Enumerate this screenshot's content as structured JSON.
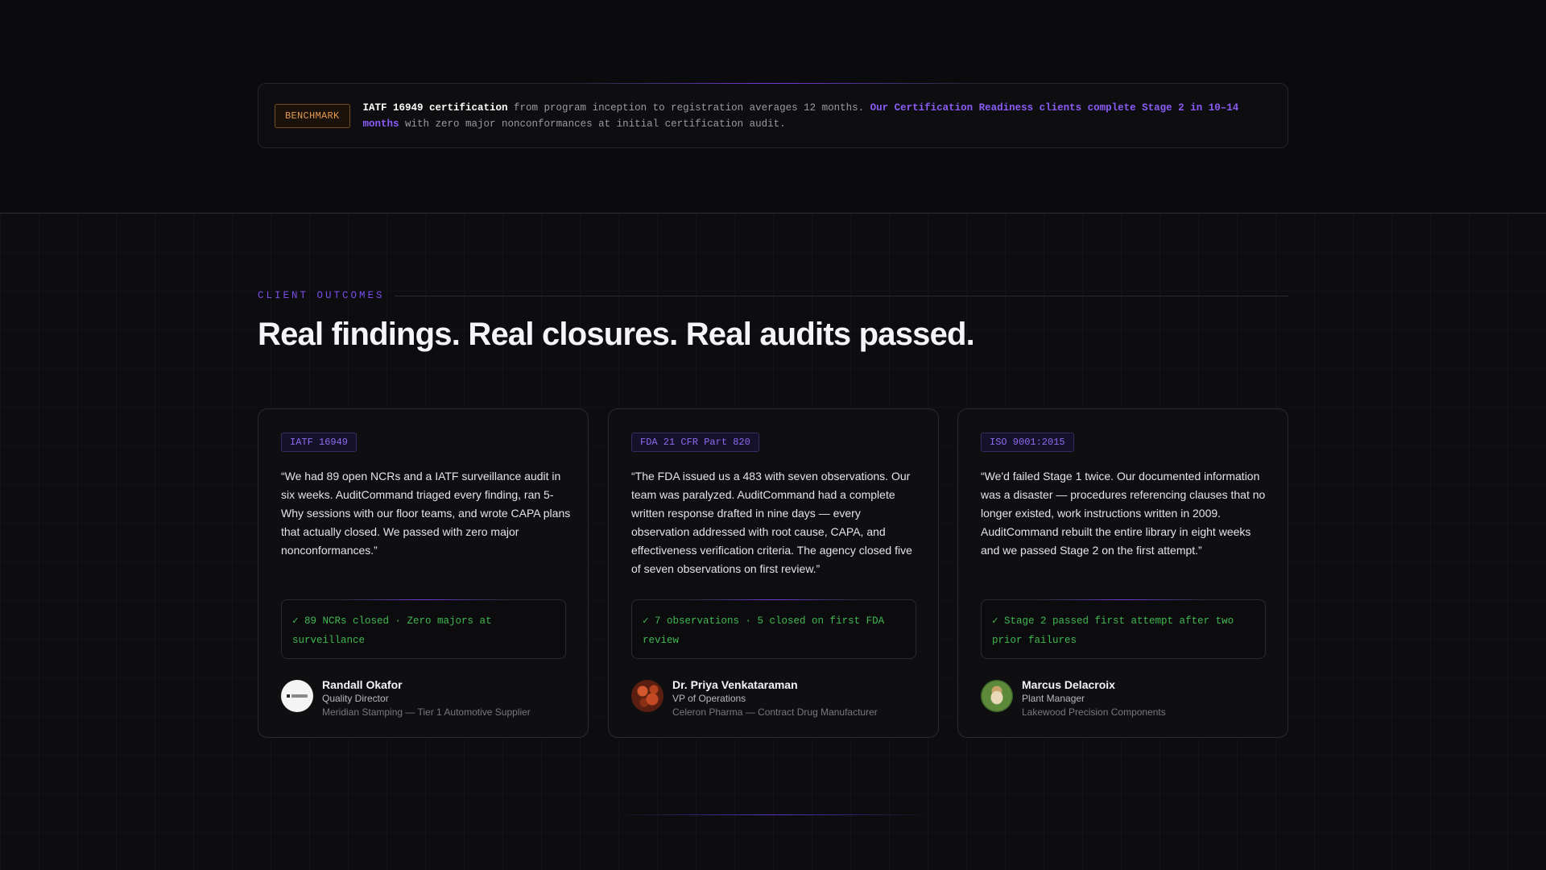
{
  "benchmark": {
    "badge": "BENCHMARK",
    "strong_text": "IATF 16949 certification",
    "text_1": " from program inception to registration averages 12 months. ",
    "accent_text": "Our Certification Readiness clients complete Stage 2 in 10–14 months",
    "text_2": " with zero major nonconformances at initial certification audit."
  },
  "outcomes": {
    "eyebrow": "CLIENT OUTCOMES",
    "headline": "Real findings. Real closures. Real audits passed.",
    "cards": [
      {
        "tag": "IATF 16949",
        "quote": "“We had 89 open NCRs and a IATF surveillance audit in six weeks. AuditCommand triaged every finding, ran 5-Why sessions with our floor teams, and wrote CAPA plans that actually closed. We passed with zero major nonconformances.”",
        "result": "✓ 89 NCRs closed · Zero majors at surveillance",
        "name": "Randall Okafor",
        "role": "Quality Director",
        "org": "Meridian Stamping — Tier 1 Automotive Supplier",
        "avatar": "company-logo-avatar"
      },
      {
        "tag": "FDA 21 CFR Part 820",
        "quote": "“The FDA issued us a 483 with seven observations. Our team was paralyzed. AuditCommand had a complete written response drafted in nine days — every observation addressed with root cause, CAPA, and effectiveness verification criteria. The agency closed five of seven observations on first review.”",
        "result": "✓ 7 observations · 5 closed on first FDA review",
        "name": "Dr. Priya Venkataraman",
        "role": "VP of Operations",
        "org": "Celeron Pharma — Contract Drug Manufacturer",
        "avatar": "profile-photo-avatar"
      },
      {
        "tag": "ISO 9001:2015",
        "quote": "“We'd failed Stage 1 twice. Our documented information was a disaster — procedures referencing clauses that no longer existed, work instructions written in 2009. AuditCommand rebuilt the entire library in eight weeks and we passed Stage 2 on the first attempt.”",
        "result": "✓ Stage 2 passed first attempt after two prior failures",
        "name": "Marcus Delacroix",
        "role": "Plant Manager",
        "org": "Lakewood Precision Components",
        "avatar": "profile-photo-avatar"
      }
    ]
  },
  "colors": {
    "background": "#0b0b0d",
    "accent_purple": "#8b5cf6",
    "badge_orange": "#e59a4e",
    "success_green": "#3fb950"
  }
}
